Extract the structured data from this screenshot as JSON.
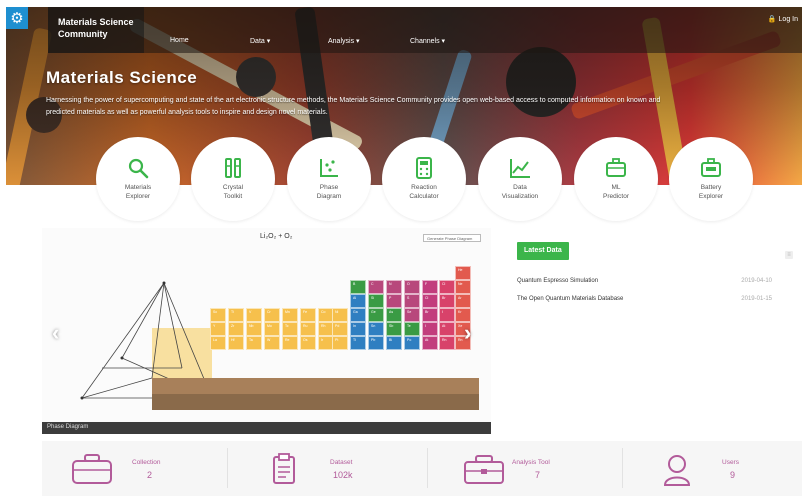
{
  "header": {
    "brand_line1": "Materials Science",
    "brand_line2": "Community",
    "nav": [
      "Home",
      "Data ▾",
      "Analysis ▾",
      "Channels ▾"
    ],
    "login": "🔒 Log In"
  },
  "hero": {
    "title": "Materials Science",
    "description": "Harnessing the power of supercomputing and state of the art electronic structure methods, the Materials Science Community provides open web-based access to computed information on known and predicted materials as well as powerful analysis tools to inspire and design novel materials."
  },
  "tools": [
    {
      "label": "Materials\nExplorer",
      "icon": "magnifier-icon"
    },
    {
      "label": "Crystal\nToolkit",
      "icon": "toolkit-icon"
    },
    {
      "label": "Phase\nDiagram",
      "icon": "phase-diagram-icon"
    },
    {
      "label": "Reaction\nCalculator",
      "icon": "calculator-icon"
    },
    {
      "label": "Data\nVisualization",
      "icon": "chart-icon"
    },
    {
      "label": "ML\nPredictor",
      "icon": "briefcase-icon"
    },
    {
      "label": "Battery\nExplorer",
      "icon": "battery-briefcase-icon"
    }
  ],
  "carousel": {
    "caption": "Phase Diagram",
    "formula": "Li₂O₂ + O₂",
    "button": "Generate Phase Diagram"
  },
  "latest": {
    "title": "Latest Data",
    "items": [
      {
        "name": "Quantum Espresso Simulation",
        "date": "2019-04-10"
      },
      {
        "name": "The Open Quantum Materials Database",
        "date": "2019-01-15"
      }
    ]
  },
  "stats": [
    {
      "label": "Collection",
      "value": "2"
    },
    {
      "label": "Dataset",
      "value": "102k"
    },
    {
      "label": "Analysis Tool",
      "value": "7"
    },
    {
      "label": "Users",
      "value": "9"
    }
  ],
  "colors": {
    "accent_green": "#3bb54a",
    "stat_purple": "#b25b9a",
    "gear_blue": "#1e8fd0",
    "tool_green": "#3bb54a"
  }
}
